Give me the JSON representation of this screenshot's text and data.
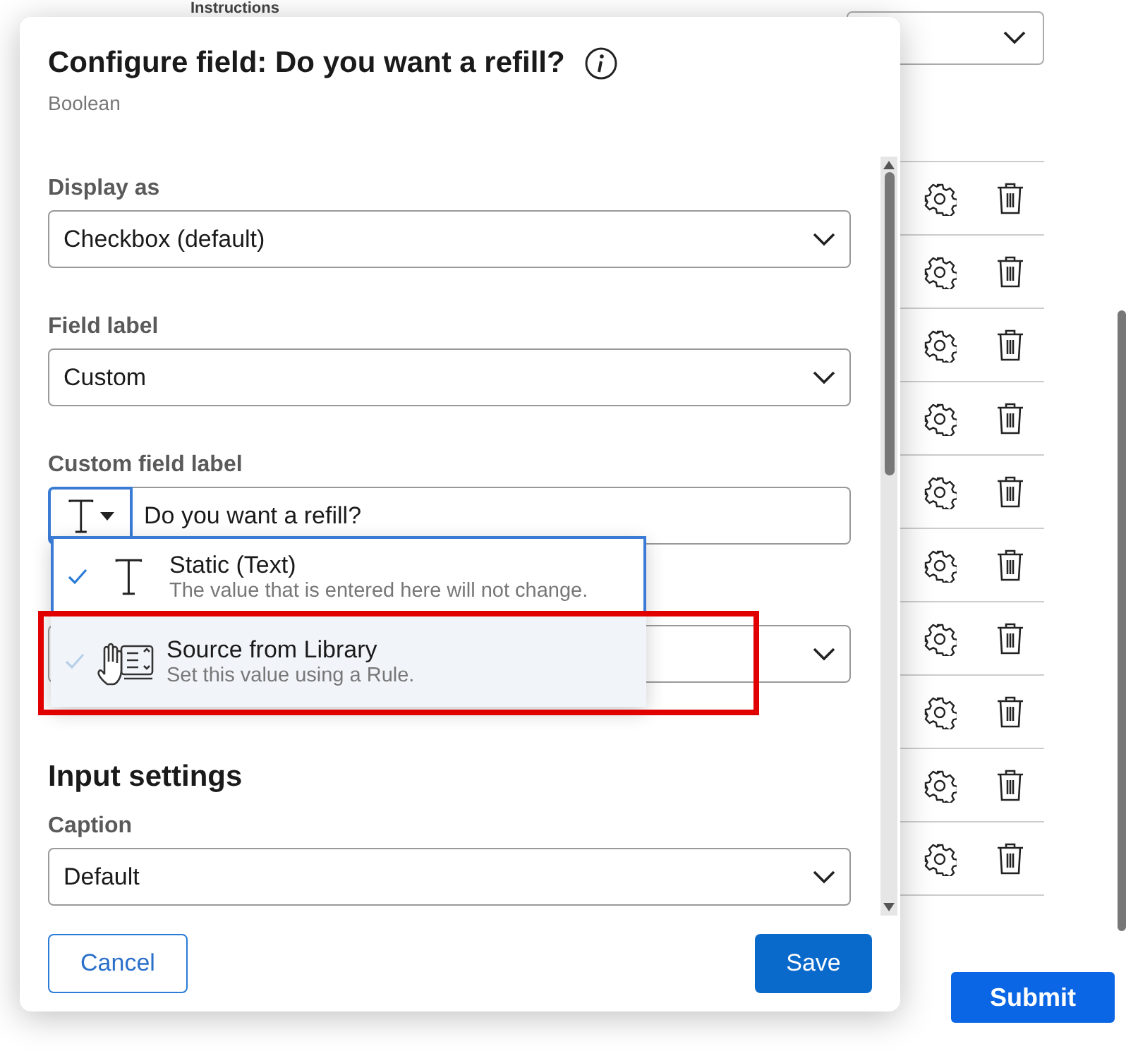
{
  "background": {
    "section_title": "Instructions",
    "submit": "Submit"
  },
  "dialog": {
    "title": "Configure field: Do you want a refill?",
    "subtitle": "Boolean",
    "fields": [
      {
        "kind": "select",
        "label": "Display as",
        "value": "Checkbox (default)"
      },
      {
        "kind": "select",
        "label": "Field label",
        "value": "Custom"
      },
      {
        "kind": "text_source",
        "label": "Custom field label",
        "value": "Do you want a refill?",
        "focused": true
      },
      {
        "kind": "select"
      }
    ],
    "section_heading": "Input settings",
    "caption": {
      "label": "Caption",
      "value": "Default"
    },
    "menu": [
      {
        "kind": "text",
        "title": "Static (Text)",
        "description": "The value that is entered here will not change.",
        "selected": true,
        "hovered": false
      },
      {
        "kind": "library",
        "title": "Source from Library",
        "description": "Set this value using a Rule.",
        "selected": false,
        "hovered": true
      }
    ],
    "cancel": "Cancel",
    "save": "Save"
  }
}
